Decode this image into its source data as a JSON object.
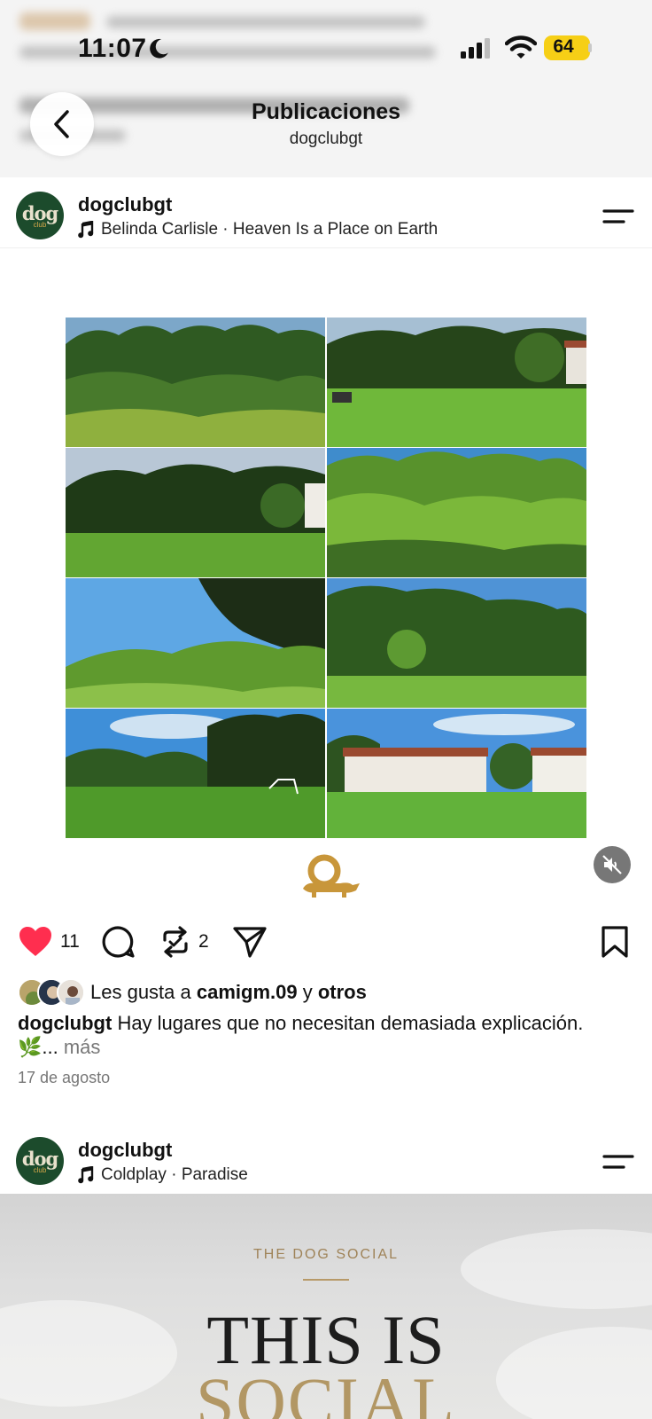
{
  "status_bar": {
    "time": "11:07",
    "battery": "64"
  },
  "header": {
    "title": "Publicaciones",
    "subtitle": "dogclubgt"
  },
  "post1": {
    "username": "dogclubgt",
    "avatar_text": "dog",
    "avatar_subtext": "club",
    "music": "Belinda Carlisle · Heaven Is a Place on Earth",
    "likes_count": "11",
    "reposts_count": "2",
    "liked_by_prefix": "Les gusta a",
    "liked_by_user": "camigm.09",
    "liked_by_joiner": "y",
    "liked_by_others": "otros",
    "caption_user": "dogclubgt",
    "caption_text": "Hay lugares que no necesitan demasiada explicación. 🌿...",
    "caption_more": "más",
    "date": "17 de agosto"
  },
  "post2": {
    "username": "dogclubgt",
    "avatar_text": "dog",
    "avatar_subtext": "club",
    "music": "Coldplay · Paradise",
    "eyebrow": "THE DOG SOCIAL",
    "headline_1": "THIS IS",
    "headline_2": "SOCIAL"
  },
  "colors": {
    "like_red": "#ff2e4f",
    "brand_green": "#1c4b2c",
    "brand_gold": "#c8963a",
    "battery_yellow": "#f6cf16"
  }
}
